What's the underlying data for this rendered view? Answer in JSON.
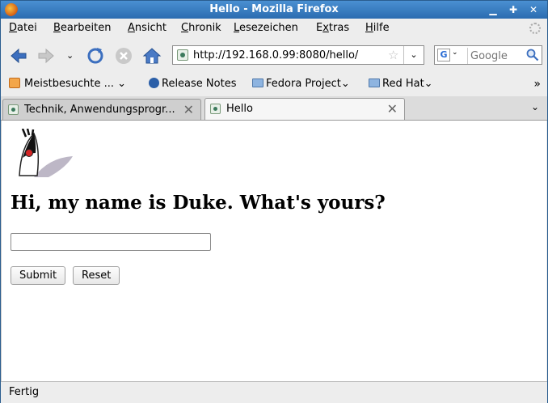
{
  "window": {
    "title": "Hello - Mozilla Firefox"
  },
  "menu": [
    {
      "pre": "",
      "u": "D",
      "post": "atei"
    },
    {
      "pre": "",
      "u": "B",
      "post": "earbeiten"
    },
    {
      "pre": "",
      "u": "A",
      "post": "nsicht"
    },
    {
      "pre": "",
      "u": "C",
      "post": "hronik"
    },
    {
      "pre": "",
      "u": "L",
      "post": "esezeichen"
    },
    {
      "pre": "E",
      "u": "x",
      "post": "tras"
    },
    {
      "pre": "",
      "u": "H",
      "post": "ilfe"
    }
  ],
  "nav": {
    "url": "http://192.168.0.99:8080/hello/",
    "search_placeholder": "Google"
  },
  "bookmarks": {
    "most_visited": "Meistbesuchte ...",
    "release_notes": "Release Notes",
    "fedora_project": "Fedora Project",
    "red_hat": "Red Hat",
    "overflow": "»"
  },
  "tabs": [
    {
      "label": "Technik, Anwendungsprogr..."
    },
    {
      "label": "Hello"
    }
  ],
  "page": {
    "heading": "Hi, my name is Duke. What's yours?",
    "name_value": "",
    "submit_label": "Submit",
    "reset_label": "Reset"
  },
  "status": {
    "text": "Fertig"
  },
  "colors": {
    "titlebar": "#2b6cb0",
    "accent": "#3c6fbf"
  }
}
